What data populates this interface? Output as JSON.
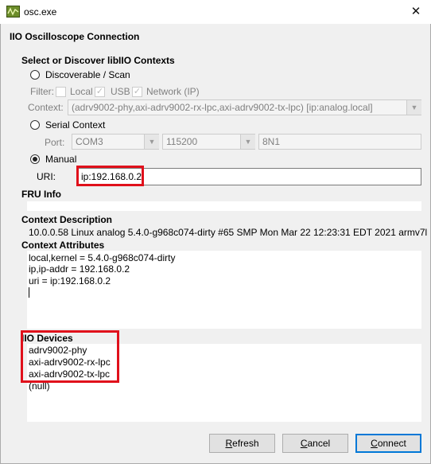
{
  "window": {
    "title": "osc.exe",
    "close_glyph": "✕"
  },
  "header": {
    "title": "IIO Oscilloscope Connection"
  },
  "select": {
    "title": "Select or Discover libIIO Contexts",
    "discover_label": "Discoverable / Scan",
    "filter_label": "Filter:",
    "filter_local": "Local",
    "filter_usb": "USB",
    "filter_network": "Network (IP)",
    "context_label": "Context:",
    "context_value": "(adrv9002-phy,axi-adrv9002-rx-lpc,axi-adrv9002-tx-lpc) [ip:analog.local]",
    "serial_label": "Serial Context",
    "port_label": "Port:",
    "port_value": "COM3",
    "baud_value": "115200",
    "format_value": "8N1",
    "manual_label": "Manual",
    "uri_label": "URI:",
    "uri_value": "ip:192.168.0.2",
    "selected_mode": "Manual"
  },
  "fru": {
    "title": "FRU Info"
  },
  "context_description": {
    "title": "Context Description",
    "text": "10.0.0.58 Linux analog 5.4.0-g968c074-dirty #65 SMP Mon Mar 22 12:23:31 EDT 2021 armv7l"
  },
  "context_attributes": {
    "title": "Context Attributes",
    "lines": [
      "local,kernel = 5.4.0-g968c074-dirty",
      "ip,ip-addr = 192.168.0.2",
      "uri = ip:192.168.0.2"
    ]
  },
  "iio_devices": {
    "title": "IIO Devices",
    "items": [
      "adrv9002-phy",
      "axi-adrv9002-rx-lpc",
      "axi-adrv9002-tx-lpc",
      "(null)"
    ]
  },
  "buttons": {
    "refresh_mnemonic": "R",
    "refresh_rest": "efresh",
    "cancel_mnemonic": "C",
    "cancel_rest": "ancel",
    "connect_mnemonic": "C",
    "connect_rest": "onnect"
  },
  "colors": {
    "highlight": "#e0101b",
    "default_button": "#0078d7"
  },
  "icons": {
    "app": "oscilloscope-app-icon",
    "close": "close-icon",
    "dropdown": "chevron-down-icon"
  }
}
